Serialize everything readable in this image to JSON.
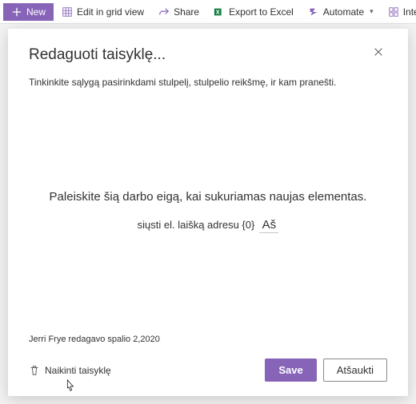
{
  "toolbar": {
    "new_label": "New",
    "edit_grid_label": "Edit in grid view",
    "share_label": "Share",
    "export_label": "Export to Excel",
    "automate_label": "Automate",
    "integrate_label": "Integrate"
  },
  "panel": {
    "title": "Redaguoti taisyklę...",
    "subtitle": "Tinkinkite sąlygą pasirinkdami stulpelį, stulpelio reikšmę, ir kam pranešti.",
    "workflow_desc": "Paleiskite šią darbo eigą, kai sukuriamas naujas elementas.",
    "send_prefix": "siųsti el. laišką adresu {0}",
    "send_value": "Aš",
    "meta": "Jerri Frye redagavo spalio 2,2020",
    "delete_label": "Naikinti taisyklę",
    "save_label": "Save",
    "cancel_label": "Atšaukti"
  }
}
